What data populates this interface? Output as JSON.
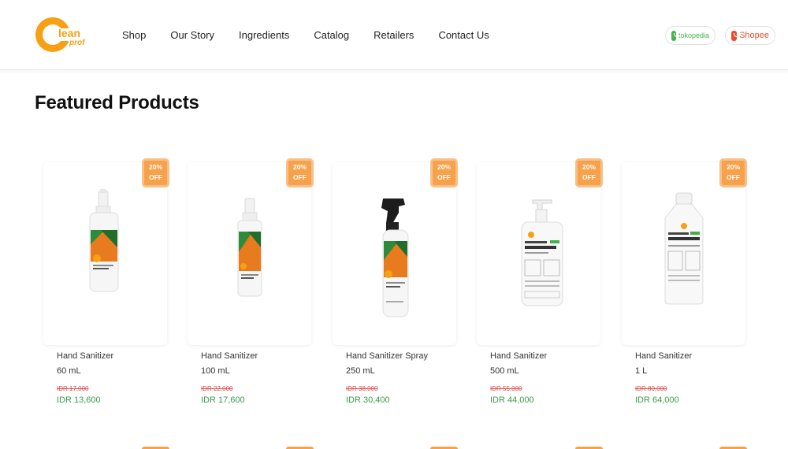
{
  "brand": {
    "logo_text": "Clean prof",
    "accent_color": "#f7a014"
  },
  "nav": {
    "items": [
      "Shop",
      "Our Story",
      "Ingredients",
      "Catalog",
      "Retailers",
      "Contact Us"
    ]
  },
  "marketplaces": {
    "tokopedia_label": "tokopedia",
    "tokopedia_icon": "tokopedia-bag-icon",
    "shopee_label": "Shopee",
    "shopee_icon": "shopee-bag-icon"
  },
  "section": {
    "title": "Featured Products"
  },
  "products": [
    {
      "badge_line1": "20%",
      "badge_line2": "OFF",
      "name": "Hand Sanitizer",
      "size": "60 mL",
      "old_price": "IDR 17,000",
      "new_price": "IDR 13,600",
      "image": "spray-bottle-60ml"
    },
    {
      "badge_line1": "20%",
      "badge_line2": "OFF",
      "name": "Hand Sanitizer",
      "size": "100 mL",
      "old_price": "IDR 22,000",
      "new_price": "IDR 17,600",
      "image": "spray-bottle-100ml"
    },
    {
      "badge_line1": "20%",
      "badge_line2": "OFF",
      "name": "Hand Sanitizer Spray",
      "size": "250 mL",
      "old_price": "IDR 38,000",
      "new_price": "IDR 30,400",
      "image": "trigger-spray-bottle-250ml"
    },
    {
      "badge_line1": "20%",
      "badge_line2": "OFF",
      "name": "Hand Sanitizer",
      "size": "500 mL",
      "old_price": "IDR 55,000",
      "new_price": "IDR 44,000",
      "image": "pump-bottle-500ml"
    },
    {
      "badge_line1": "20%",
      "badge_line2": "OFF",
      "name": "Hand Sanitizer",
      "size": "1 L",
      "old_price": "IDR 80,000",
      "new_price": "IDR 64,000",
      "image": "refill-bottle-1l"
    }
  ],
  "colors": {
    "badge": "#f7a14a",
    "old_price": "#e04848",
    "new_price": "#3a9a4a"
  }
}
